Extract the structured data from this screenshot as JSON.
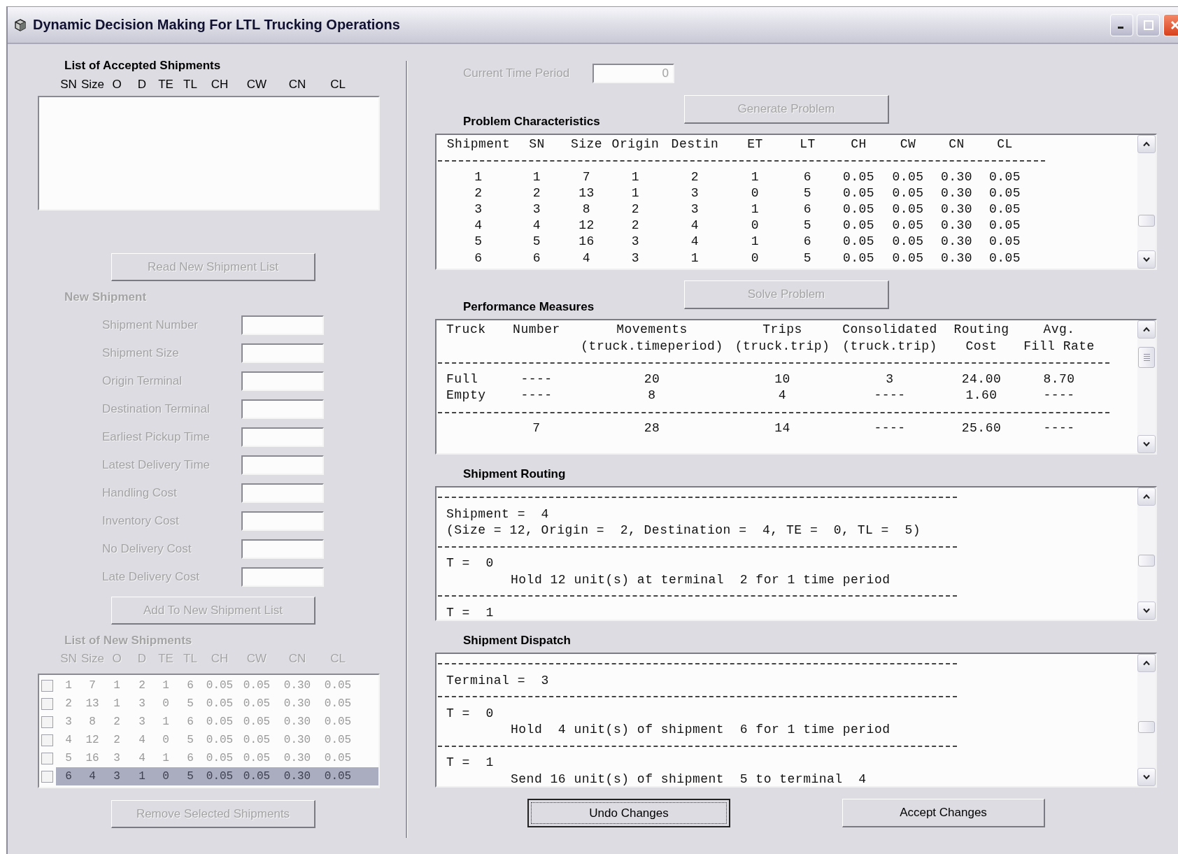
{
  "window": {
    "title": "Dynamic Decision Making For LTL Trucking Operations"
  },
  "accepted_shipments": {
    "title": "List of Accepted Shipments",
    "columns": [
      "SN",
      "Size",
      "O",
      "D",
      "TE",
      "TL",
      "CH",
      "CW",
      "CN",
      "CL"
    ]
  },
  "read_button": {
    "label": "Read New Shipment List",
    "disabled": true
  },
  "new_shipment": {
    "title": "New Shipment",
    "disabled": true,
    "fields": [
      {
        "label": "Shipment Number"
      },
      {
        "label": "Shipment Size"
      },
      {
        "label": "Origin Terminal"
      },
      {
        "label": "Destination Terminal"
      },
      {
        "label": "Earliest Pickup Time"
      },
      {
        "label": "Latest Delivery Time"
      },
      {
        "label": "Handling Cost"
      },
      {
        "label": "Inventory Cost"
      },
      {
        "label": "No Delivery Cost"
      },
      {
        "label": "Late Delivery Cost"
      }
    ]
  },
  "add_button": {
    "label": "Add To New Shipment List",
    "disabled": true
  },
  "new_shipments": {
    "title": "List of New Shipments",
    "disabled": true,
    "columns": [
      "SN",
      "Size",
      "O",
      "D",
      "TE",
      "TL",
      "CH",
      "CW",
      "CN",
      "CL"
    ],
    "rows": [
      {
        "checked": false,
        "selected": false,
        "cells": [
          "1",
          "7",
          "1",
          "2",
          "1",
          "6",
          "0.05",
          "0.05",
          "0.30",
          "0.05"
        ]
      },
      {
        "checked": false,
        "selected": false,
        "cells": [
          "2",
          "13",
          "1",
          "3",
          "0",
          "5",
          "0.05",
          "0.05",
          "0.30",
          "0.05"
        ]
      },
      {
        "checked": false,
        "selected": false,
        "cells": [
          "3",
          "8",
          "2",
          "3",
          "1",
          "6",
          "0.05",
          "0.05",
          "0.30",
          "0.05"
        ]
      },
      {
        "checked": false,
        "selected": false,
        "cells": [
          "4",
          "12",
          "2",
          "4",
          "0",
          "5",
          "0.05",
          "0.05",
          "0.30",
          "0.05"
        ]
      },
      {
        "checked": false,
        "selected": false,
        "cells": [
          "5",
          "16",
          "3",
          "4",
          "1",
          "6",
          "0.05",
          "0.05",
          "0.30",
          "0.05"
        ]
      },
      {
        "checked": false,
        "selected": true,
        "cells": [
          "6",
          "4",
          "3",
          "1",
          "0",
          "5",
          "0.05",
          "0.05",
          "0.30",
          "0.05"
        ]
      }
    ]
  },
  "remove_button": {
    "label": "Remove Selected Shipments",
    "disabled": true
  },
  "time_period": {
    "label": "Current Time Period",
    "value": "0",
    "disabled": true
  },
  "generate_button": {
    "label": "Generate Problem",
    "disabled": true
  },
  "problem": {
    "title": "Problem Characteristics",
    "columns": [
      "Shipment",
      "SN",
      "Size",
      "Origin",
      "Destin",
      "ET",
      "LT",
      "CH",
      "CW",
      "CN",
      "CL"
    ],
    "rows": [
      [
        "1",
        "1",
        "7",
        "1",
        "2",
        "1",
        "6",
        "0.05",
        "0.05",
        "0.30",
        "0.05"
      ],
      [
        "2",
        "2",
        "13",
        "1",
        "3",
        "0",
        "5",
        "0.05",
        "0.05",
        "0.30",
        "0.05"
      ],
      [
        "3",
        "3",
        "8",
        "2",
        "3",
        "1",
        "6",
        "0.05",
        "0.05",
        "0.30",
        "0.05"
      ],
      [
        "4",
        "4",
        "12",
        "2",
        "4",
        "0",
        "5",
        "0.05",
        "0.05",
        "0.30",
        "0.05"
      ],
      [
        "5",
        "5",
        "16",
        "3",
        "4",
        "1",
        "6",
        "0.05",
        "0.05",
        "0.30",
        "0.05"
      ],
      [
        "6",
        "6",
        "4",
        "3",
        "1",
        "0",
        "5",
        "0.05",
        "0.05",
        "0.30",
        "0.05"
      ]
    ]
  },
  "solve_button": {
    "label": "Solve Problem",
    "disabled": true
  },
  "performance": {
    "title": "Performance Measures",
    "columns": [
      {
        "lines": [
          "Truck"
        ]
      },
      {
        "lines": [
          "Number"
        ]
      },
      {
        "lines": [
          "Movements",
          "(truck.timeperiod)"
        ]
      },
      {
        "lines": [
          "Trips",
          "(truck.trip)"
        ]
      },
      {
        "lines": [
          "Consolidated",
          "(truck.trip)"
        ]
      },
      {
        "lines": [
          "Routing",
          "Cost"
        ]
      },
      {
        "lines": [
          "Avg.",
          "Fill Rate"
        ]
      }
    ],
    "rows": [
      {
        "kind": "detail",
        "cells": [
          "Full",
          "----",
          "20",
          "10",
          "3",
          "24.00",
          "8.70"
        ]
      },
      {
        "kind": "detail",
        "cells": [
          "Empty",
          "----",
          "8",
          "4",
          "----",
          "1.60",
          "----"
        ]
      },
      {
        "kind": "total",
        "cells": [
          "",
          "7",
          "28",
          "14",
          "----",
          "25.60",
          "----"
        ]
      }
    ]
  },
  "routing": {
    "title": "Shipment Routing",
    "lines": [
      {
        "kind": "rule"
      },
      {
        "kind": "text",
        "text": "Shipment =  4"
      },
      {
        "kind": "text",
        "text": "(Size = 12, Origin =  2, Destination =  4, TE =  0, TL =  5)"
      },
      {
        "kind": "rule"
      },
      {
        "kind": "text",
        "text": "T =  0"
      },
      {
        "kind": "indented",
        "text": "Hold 12 unit(s) at terminal  2 for 1 time period"
      },
      {
        "kind": "rule"
      },
      {
        "kind": "text",
        "text": "T =  1"
      }
    ]
  },
  "dispatch": {
    "title": "Shipment Dispatch",
    "lines": [
      {
        "kind": "rule"
      },
      {
        "kind": "text",
        "text": "Terminal =  3"
      },
      {
        "kind": "rule"
      },
      {
        "kind": "text",
        "text": "T =  0"
      },
      {
        "kind": "indented",
        "text": "Hold  4 unit(s) of shipment  6 for 1 time period"
      },
      {
        "kind": "rule"
      },
      {
        "kind": "text",
        "text": "T =  1"
      },
      {
        "kind": "indented",
        "text": "Send 16 unit(s) of shipment  5 to terminal  4"
      }
    ]
  },
  "buttons": [
    {
      "label": "Undo Changes",
      "disabled": false,
      "focused": true
    },
    {
      "label": "Accept Changes",
      "disabled": false,
      "focused": false
    }
  ]
}
